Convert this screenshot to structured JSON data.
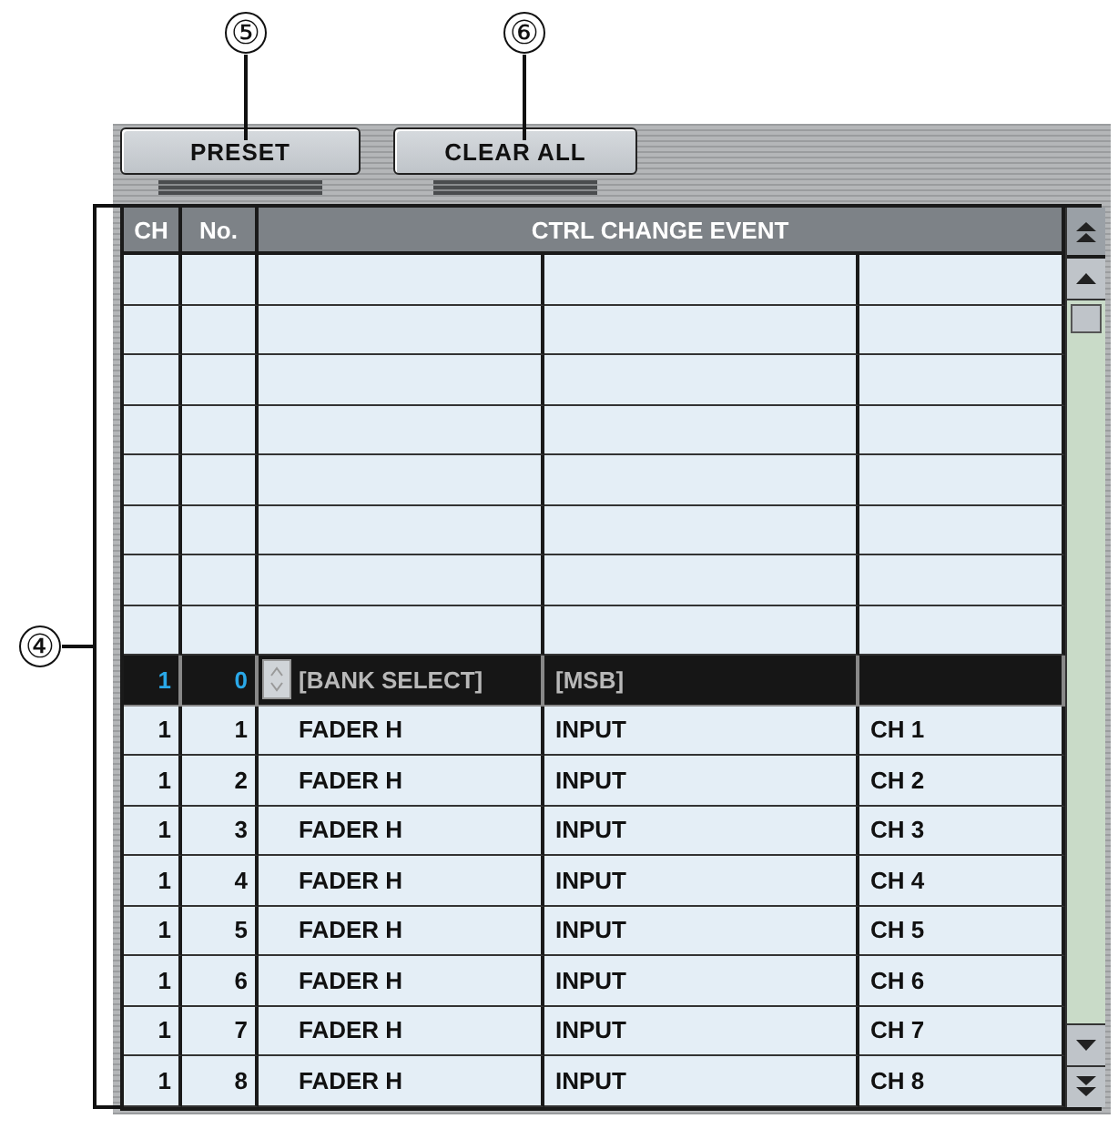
{
  "callouts": [
    {
      "label": "⑤"
    },
    {
      "label": "⑥"
    },
    {
      "label": "④"
    }
  ],
  "buttons": [
    {
      "label": "PRESET"
    },
    {
      "label": "CLEAR ALL"
    }
  ],
  "table": {
    "columns": [
      {
        "label": "CH"
      },
      {
        "label": "No."
      },
      {
        "label": "CTRL CHANGE EVENT"
      }
    ],
    "rows": [
      {
        "selected": false
      },
      {
        "selected": false
      },
      {
        "selected": false
      },
      {
        "selected": false
      },
      {
        "selected": false
      },
      {
        "selected": false
      },
      {
        "selected": false
      },
      {
        "selected": false
      },
      {
        "selected": true,
        "ch": "1",
        "no": "0",
        "event_1": "[BANK SELECT]",
        "event_2": "[MSB]"
      },
      {
        "selected": false,
        "ch": "1",
        "no": "1",
        "event_1": "FADER H",
        "event_2": "INPUT",
        "event_3": "CH 1"
      },
      {
        "selected": false,
        "ch": "1",
        "no": "2",
        "event_1": "FADER H",
        "event_2": "INPUT",
        "event_3": "CH 2"
      },
      {
        "selected": false,
        "ch": "1",
        "no": "3",
        "event_1": "FADER H",
        "event_2": "INPUT",
        "event_3": "CH 3"
      },
      {
        "selected": false,
        "ch": "1",
        "no": "4",
        "event_1": "FADER H",
        "event_2": "INPUT",
        "event_3": "CH 4"
      },
      {
        "selected": false,
        "ch": "1",
        "no": "5",
        "event_1": "FADER H",
        "event_2": "INPUT",
        "event_3": "CH 5"
      },
      {
        "selected": false,
        "ch": "1",
        "no": "6",
        "event_1": "FADER H",
        "event_2": "INPUT",
        "event_3": "CH 6"
      },
      {
        "selected": false,
        "ch": "1",
        "no": "7",
        "event_1": "FADER H",
        "event_2": "INPUT",
        "event_3": "CH 7"
      },
      {
        "selected": false,
        "ch": "1",
        "no": "8",
        "event_1": "FADER H",
        "event_2": "INPUT",
        "event_3": "CH 8"
      }
    ]
  }
}
